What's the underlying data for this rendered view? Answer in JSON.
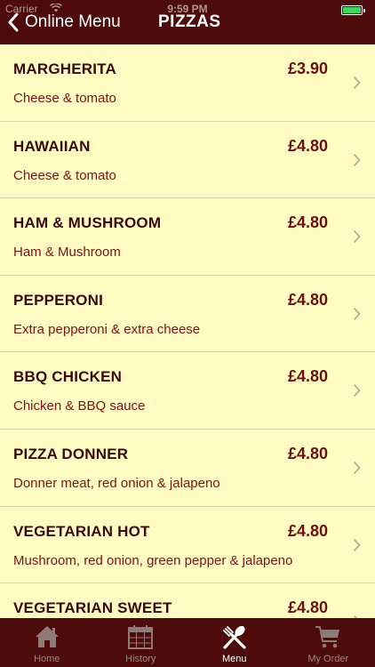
{
  "status_bar": {
    "carrier": "Carrier",
    "time": "9:59 PM"
  },
  "nav": {
    "back_label": "Online Menu",
    "title": "PIZZAS"
  },
  "menu": {
    "items": [
      {
        "name": "MARGHERITA",
        "price": "£3.90",
        "description": "Cheese & tomato"
      },
      {
        "name": "HAWAIIAN",
        "price": "£4.80",
        "description": "Cheese & tomato"
      },
      {
        "name": "HAM & MUSHROOM",
        "price": "£4.80",
        "description": "Ham & Mushroom"
      },
      {
        "name": "PEPPERONI",
        "price": "£4.80",
        "description": "Extra pepperoni & extra cheese"
      },
      {
        "name": "BBQ CHICKEN",
        "price": "£4.80",
        "description": "Chicken & BBQ sauce"
      },
      {
        "name": "PIZZA DONNER",
        "price": "£4.80",
        "description": "Donner meat, red onion & jalapeno"
      },
      {
        "name": "VEGETARIAN HOT",
        "price": "£4.80",
        "description": "Mushroom, red onion, green pepper & jalapeno"
      },
      {
        "name": "VEGETARIAN SWEET",
        "price": "£4.80",
        "description": ""
      }
    ]
  },
  "tab_bar": {
    "tabs": [
      {
        "label": "Home",
        "icon": "home-icon",
        "active": false
      },
      {
        "label": "History",
        "icon": "calendar-icon",
        "active": false
      },
      {
        "label": "Menu",
        "icon": "fork-spoon-icon",
        "active": true
      },
      {
        "label": "My Order",
        "icon": "cart-icon",
        "active": false
      }
    ]
  },
  "colors": {
    "header_bg": "#4E0B0B",
    "list_bg": "#FFFBC3",
    "text_dark": "#3A0A0A",
    "text_red": "#7A1414",
    "battery_green": "#3DD65B"
  }
}
